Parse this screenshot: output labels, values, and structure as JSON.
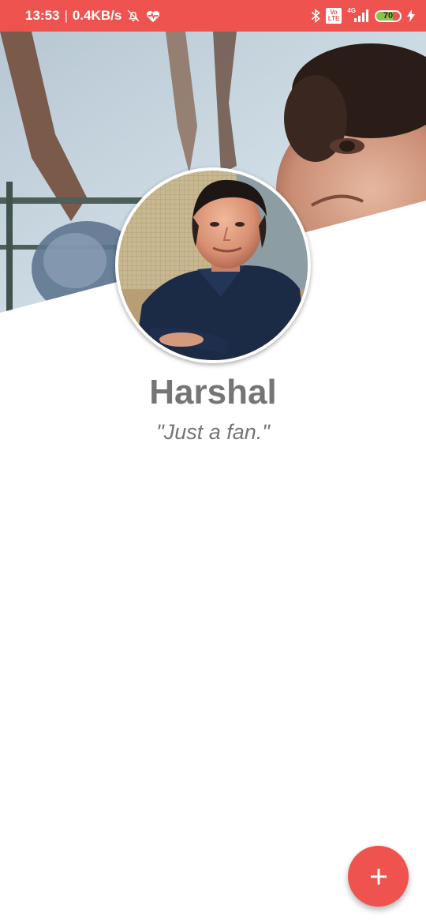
{
  "status_bar": {
    "time": "13:53",
    "separator": "|",
    "network_speed": "0.4KB/s",
    "icons": [
      "alarm-off-icon",
      "heart-monitor-icon",
      "bluetooth-icon",
      "volte-icon",
      "signal-icon",
      "battery-icon",
      "charging-icon"
    ],
    "volte_line1": "Vo",
    "volte_line2": "LTE",
    "network_type": "4G",
    "battery_level": "70",
    "battery_fraction": 0.7
  },
  "profile": {
    "name": "Harshal",
    "tagline": "\"Just a fan.\""
  },
  "fab": {
    "icon": "plus-icon"
  },
  "colors": {
    "accent": "#ef5350",
    "text_muted": "#757575",
    "battery_green": "#8bc34a"
  }
}
